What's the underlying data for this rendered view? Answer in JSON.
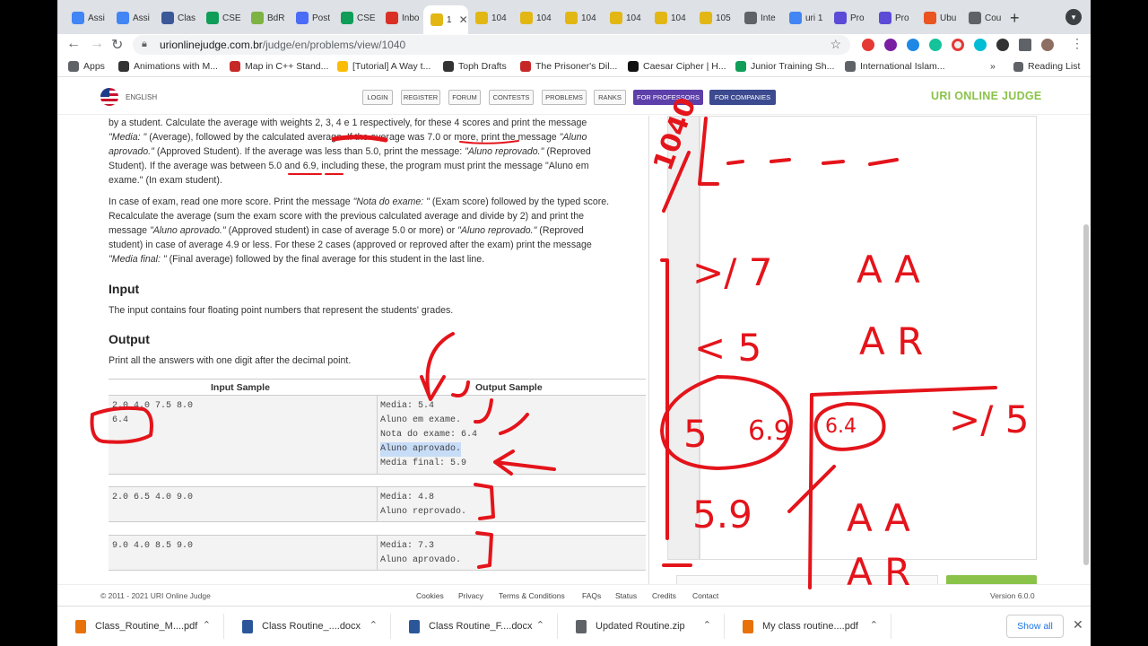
{
  "browser": {
    "tabs": [
      {
        "title": "Assi",
        "color": "#4285f4"
      },
      {
        "title": "Assi",
        "color": "#4285f4"
      },
      {
        "title": "Clas",
        "color": "#3b5998"
      },
      {
        "title": "CSE",
        "color": "#0f9d58"
      },
      {
        "title": "BdR",
        "color": "#7cb342"
      },
      {
        "title": "Post",
        "color": "#4a6cf7"
      },
      {
        "title": "CSE",
        "color": "#0f9d58"
      },
      {
        "title": "Inbo",
        "color": "#d93025"
      },
      {
        "title": "1",
        "color": "#e2b714",
        "active": true
      },
      {
        "title": "104",
        "color": "#e2b714"
      },
      {
        "title": "104",
        "color": "#e2b714"
      },
      {
        "title": "104",
        "color": "#e2b714"
      },
      {
        "title": "104",
        "color": "#e2b714"
      },
      {
        "title": "104",
        "color": "#e2b714"
      },
      {
        "title": "105",
        "color": "#e2b714"
      },
      {
        "title": "Inte",
        "color": "#5f6368"
      },
      {
        "title": "uri 1",
        "color": "#4285f4"
      },
      {
        "title": "Pro",
        "color": "#5b4bd6"
      },
      {
        "title": "Pro",
        "color": "#5b4bd6"
      },
      {
        "title": "Ubu",
        "color": "#e95420"
      },
      {
        "title": "Cou",
        "color": "#5f6368"
      }
    ],
    "url_host": "urionlinejudge.com.br",
    "url_path": "/judge/en/problems/view/1040",
    "bookmarks": [
      {
        "label": "Apps",
        "color": "#5f6368"
      },
      {
        "label": "Animations with M...",
        "color": "#333"
      },
      {
        "label": "Map in C++ Stand...",
        "color": "#c62828"
      },
      {
        "label": "[Tutorial] A Way t...",
        "color": "#fbbc04"
      },
      {
        "label": "Toph Drafts",
        "color": "#333"
      },
      {
        "label": "The Prisoner's Dil...",
        "color": "#c62828"
      },
      {
        "label": "Caesar Cipher | H...",
        "color": "#111"
      },
      {
        "label": "Junior Training Sh...",
        "color": "#0f9d58"
      },
      {
        "label": "International Islam...",
        "color": "#5f6368"
      }
    ],
    "reading_list": "Reading List"
  },
  "site": {
    "language": "ENGLISH",
    "nav": [
      "LOGIN",
      "REGISTER",
      "FORUM",
      "CONTESTS",
      "PROBLEMS",
      "RANKS",
      "FOR PROFESSORS",
      "FOR COMPANIES"
    ],
    "logo": "URI ONLINE JUDGE"
  },
  "problem": {
    "para1": {
      "l1": "by a student. Calculate the average with weights 2, 3, 4 e 1 respectively, for these 4 scores and print the message",
      "l2a": "\"Media: \"",
      "l2b": " (Average), followed by the calculated ",
      "l2c": "average. If the average was 7.0 or more, print the message ",
      "l2d": "\"Aluno",
      "l3a": "aprovado.\"",
      "l3b": " (Approved Student). If the average was less than 5.0, print the message: ",
      "l3c": "\"Aluno reprovado.\"",
      "l3d": " (Reproved",
      "l4": "Student). If the average was between 5.0 and 6.9, including these, the program must print the message \"Aluno em",
      "l5": "exame.\" (In exam student)."
    },
    "para2": {
      "l1a": "In case of exam, read one more score. Print the message ",
      "l1b": "\"Nota do exame: \"",
      "l1c": " (Exam score) followed by the typed score.",
      "l2": "Recalculate the average (sum the exam score with the previous calculated average and divide by 2) and print the",
      "l3a": "message ",
      "l3b": "\"Aluno aprovado.\"",
      "l3c": " (Approved student) in case of average 5.0 or more) or ",
      "l3d": "\"Aluno reprovado.\"",
      "l3e": " (Reproved",
      "l4": "student) in case of average 4.9 or less. For these 2 cases (approved or reproved after the exam) print the message",
      "l5a": "\"Media final: \"",
      "l5b": " (Final average) followed by the final average for this student in the last line."
    },
    "input_title": "Input",
    "input_text": "The input contains four floating point numbers that represent the students' grades.",
    "output_title": "Output",
    "output_text": "Print all the answers with one digit after the decimal point.",
    "sample_input_header": "Input Sample",
    "sample_output_header": "Output Sample",
    "samples": [
      {
        "input": [
          "2.0 4.0 7.5 8.0",
          "6.4"
        ],
        "output": [
          "Media: 5.4",
          "Aluno em exame.",
          "Nota do exame: 6.4",
          "Aluno aprovado.",
          "Media final: 5.9"
        ]
      },
      {
        "input": [
          "2.0 6.5 4.0 9.0"
        ],
        "output": [
          "Media: 4.8",
          "Aluno reprovado."
        ]
      },
      {
        "input": [
          "9.0 4.0 8.5 9.0"
        ],
        "output": [
          "Media: 7.3",
          "Aluno aprovado."
        ]
      }
    ]
  },
  "footer": {
    "copyright": "© 2011 - 2021 URI Online Judge",
    "links": [
      "Cookies",
      "Privacy",
      "Terms & Conditions",
      "FAQs",
      "Status",
      "Credits",
      "Contact"
    ],
    "version": "Version 6.0.0"
  },
  "downloads": {
    "items": [
      {
        "name": "Class_Routine_M....pdf",
        "color": "#e8710a"
      },
      {
        "name": "Class Routine_....docx",
        "color": "#2b579a"
      },
      {
        "name": "Class Routine_F....docx",
        "color": "#2b579a"
      },
      {
        "name": "Updated Routine.zip",
        "color": "#5f6368"
      },
      {
        "name": "My class routine....pdf",
        "color": "#e8710a"
      }
    ],
    "show_all": "Show all"
  },
  "annotations": {
    "color": "#e4141b",
    "problem_number": "1040",
    "texts": [
      ">/ 7",
      "A A",
      "< 5",
      "A R",
      "5",
      "6.9",
      "6.4",
      ">/ 5",
      "5.9",
      "A A",
      "A R"
    ]
  }
}
